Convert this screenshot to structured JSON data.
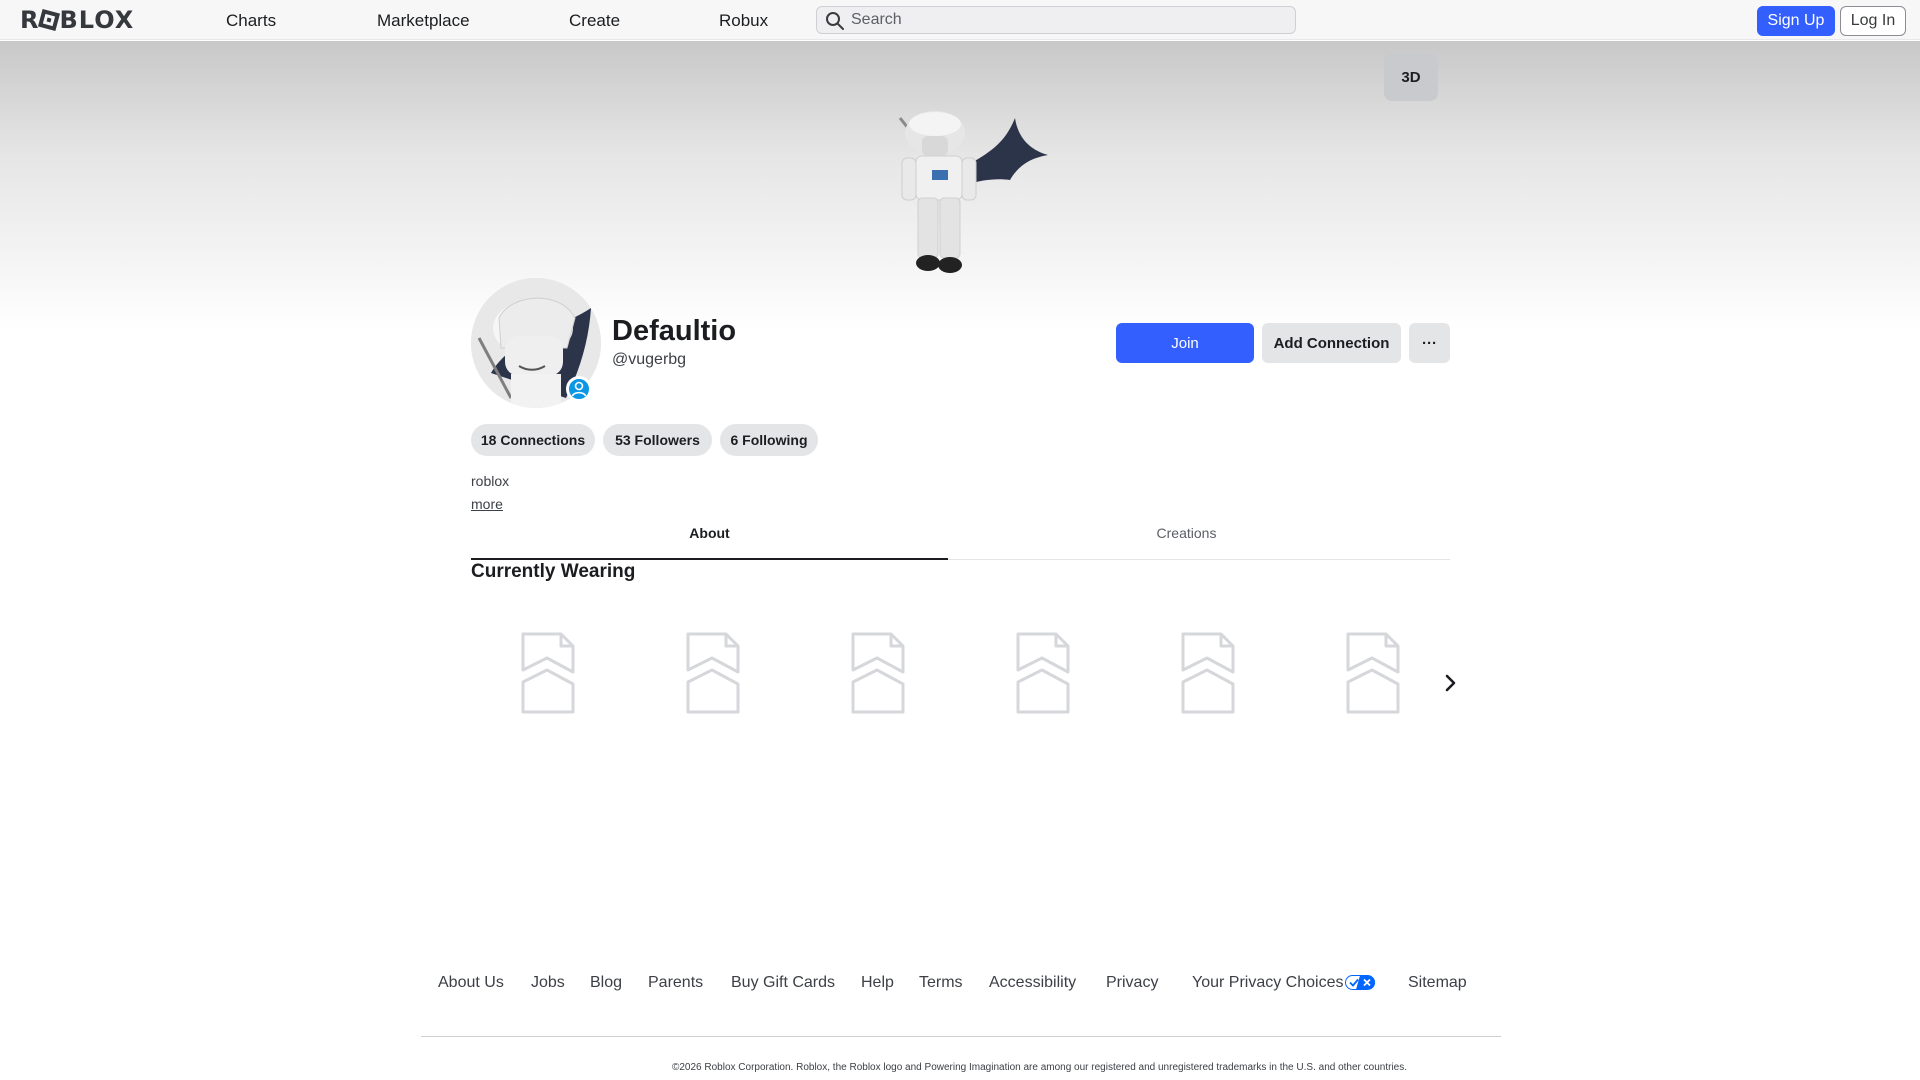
{
  "nav": {
    "logo": "ROBLOX",
    "links": [
      "Charts",
      "Marketplace",
      "Create",
      "Robux"
    ],
    "search_placeholder": "Search",
    "signup_label": "Sign Up",
    "login_label": "Log In",
    "accent_color": "#335fff"
  },
  "hero": {
    "view_toggle_label": "3D"
  },
  "profile": {
    "display_name": "Defaultio",
    "username": "@vugerbg",
    "join_label": "Join",
    "add_connection_label": "Add Connection",
    "more_label": "···",
    "stats": {
      "connections": "18 Connections",
      "followers": "53 Followers",
      "following": "6 Following"
    },
    "bio": "roblox",
    "more_link": "more"
  },
  "tabs": {
    "about": "About",
    "creations": "Creations",
    "active": "About"
  },
  "wearing": {
    "title": "Currently Wearing",
    "item_count": 6,
    "item_icon": "image-placeholder-icon"
  },
  "footer": {
    "links": [
      "About Us",
      "Jobs",
      "Blog",
      "Parents",
      "Buy Gift Cards",
      "Help",
      "Terms",
      "Accessibility",
      "Privacy",
      "Your Privacy Choices",
      "Sitemap"
    ],
    "copyright": "©2026 Roblox Corporation. Roblox, the Roblox logo and Powering Imagination are among our registered and unregistered trademarks in the U.S. and other countries."
  }
}
